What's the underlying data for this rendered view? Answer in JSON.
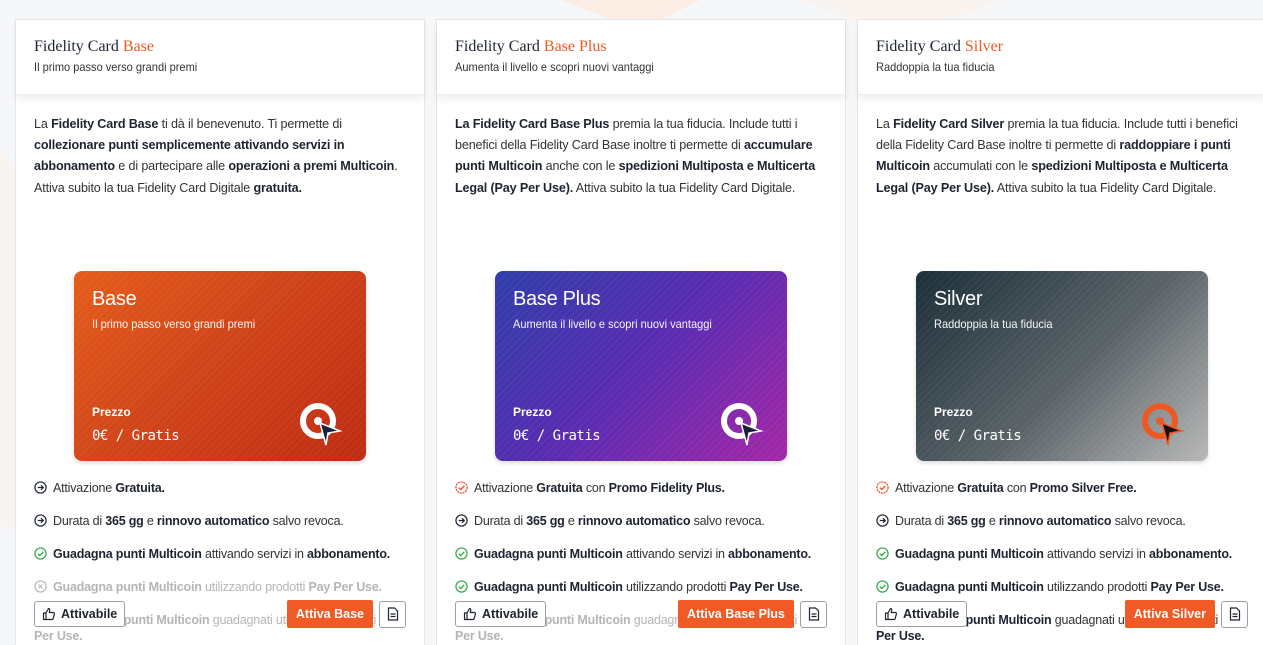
{
  "colors": {
    "accent": "#ec5a24",
    "button": "#f15a24",
    "dark_text": "#1d2430",
    "check_green": "#2ea84a",
    "promo_red": "#ea4a2a",
    "disabled": "#b5b5b5"
  },
  "plans": [
    {
      "title_prefix": "Fidelity Card",
      "title_accent": "Base",
      "subtitle": "Il primo passo verso grandi premi",
      "description_parts": [
        "La ",
        "Fidelity Card Base",
        " ti dà il benevenuto. Ti permette di ",
        "collezionare punti semplicemente attivando servizi in abbonamento",
        " e di partecipare alle ",
        "operazioni a premi Multicoin",
        ". Attiva subito la tua Fidelity Card Digitale ",
        "gratuita."
      ],
      "card": {
        "name": "Base",
        "tagline": "Il primo passo verso grandi premi",
        "price_label": "Prezzo",
        "price": "0€ / Gratis",
        "theme": "orange"
      },
      "features": [
        {
          "icon": "arrow-circle-icon",
          "state": "normal",
          "parts": [
            "Attivazione ",
            "Gratuita."
          ]
        },
        {
          "icon": "arrow-circle-icon",
          "state": "normal",
          "parts": [
            "Durata di ",
            "365 gg",
            " e ",
            "rinnovo automatico",
            " salvo revoca."
          ]
        },
        {
          "icon": "check-circle-icon",
          "state": "normal",
          "parts": [
            "",
            "Guadagna punti Multicoin",
            " attivando servizi in ",
            "abbonamento."
          ]
        },
        {
          "icon": "x-circle-icon",
          "state": "disabled",
          "parts": [
            "",
            "Guadagna punti Multicoin",
            " utilizzando prodotti ",
            "Pay Per Use."
          ]
        },
        {
          "icon": "x-circle-icon",
          "state": "disabled",
          "parts": [
            "",
            "Raddoppia i punti Multicoin",
            " guadagnati utilizzando prodotti ",
            "Pay Per Use."
          ]
        }
      ],
      "attivabile_label": "Attivabile",
      "activate_label": "Attiva Base"
    },
    {
      "title_prefix": "Fidelity Card",
      "title_accent": "Base Plus",
      "subtitle": "Aumenta il livello e scopri nuovi vantaggi",
      "description_parts": [
        "",
        "La Fidelity Card Base Plus",
        " premia la tua fiducia. Include tutti i benefici della Fidelity Card Base inoltre ti permette di ",
        "accumulare punti Multicoin",
        " anche con le ",
        "spedizioni Multiposta e Multicerta Legal (Pay Per Use).",
        " Attiva subito la tua Fidelity Card Digitale.",
        ""
      ],
      "card": {
        "name": "Base Plus",
        "tagline": "Aumenta il livello e scopri nuovi vantaggi",
        "price_label": "Prezzo",
        "price": "0€ / Gratis",
        "theme": "purple"
      },
      "features": [
        {
          "icon": "promo-check-icon",
          "state": "normal",
          "parts": [
            "Attivazione ",
            "Gratuita",
            " con ",
            "Promo Fidelity Plus."
          ]
        },
        {
          "icon": "arrow-circle-icon",
          "state": "normal",
          "parts": [
            "Durata di ",
            "365 gg",
            " e ",
            "rinnovo automatico",
            " salvo revoca."
          ]
        },
        {
          "icon": "check-circle-icon",
          "state": "normal",
          "parts": [
            "",
            "Guadagna punti Multicoin",
            " attivando servizi in ",
            "abbonamento."
          ]
        },
        {
          "icon": "check-circle-icon",
          "state": "normal",
          "parts": [
            "",
            "Guadagna punti Multicoin",
            " utilizzando prodotti ",
            "Pay Per Use."
          ]
        },
        {
          "icon": "x-circle-icon",
          "state": "disabled",
          "parts": [
            "",
            "Raddoppia i punti Multicoin",
            " guadagnati utilizzando prodotti ",
            "Pay Per Use."
          ]
        }
      ],
      "attivabile_label": "Attivabile",
      "activate_label": "Attiva Base Plus"
    },
    {
      "title_prefix": "Fidelity Card",
      "title_accent": "Silver",
      "subtitle": "Raddoppia la tua fiducia",
      "description_parts": [
        "La ",
        "Fidelity Card Silver",
        " premia la tua fiducia. Include tutti i benefici della Fidelity Card Base inoltre ti permette di ",
        "raddoppiare i punti Multicoin",
        " accumulati con le ",
        "spedizioni Multiposta e Multicerta Legal (Pay Per Use).",
        " Attiva subito la tua Fidelity Card Digitale.",
        ""
      ],
      "card": {
        "name": "Silver",
        "tagline": "Raddoppia la tua fiducia",
        "price_label": "Prezzo",
        "price": "0€ / Gratis",
        "theme": "silver"
      },
      "features": [
        {
          "icon": "promo-check-icon",
          "state": "normal",
          "parts": [
            "Attivazione ",
            "Gratuita",
            " con ",
            "Promo Silver Free."
          ]
        },
        {
          "icon": "arrow-circle-icon",
          "state": "normal",
          "parts": [
            "Durata di ",
            "365 gg",
            " e ",
            "rinnovo automatico",
            " salvo revoca."
          ]
        },
        {
          "icon": "check-circle-icon",
          "state": "normal",
          "parts": [
            "",
            "Guadagna punti Multicoin",
            " attivando servizi in ",
            "abbonamento."
          ]
        },
        {
          "icon": "check-circle-icon",
          "state": "normal",
          "parts": [
            "",
            "Guadagna punti Multicoin",
            " utilizzando prodotti ",
            "Pay Per Use."
          ]
        },
        {
          "icon": "check-circle-icon",
          "state": "normal",
          "parts": [
            "",
            "Raddoppia i punti Multicoin",
            " guadagnati utilizzando prodotti ",
            "Pay Per Use."
          ]
        }
      ],
      "attivabile_label": "Attivabile",
      "activate_label": "Attiva Silver"
    }
  ]
}
